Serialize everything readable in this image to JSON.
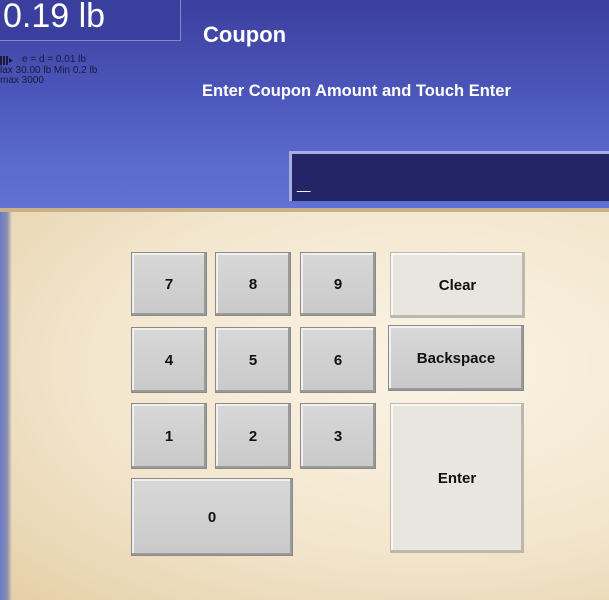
{
  "scale": {
    "weight": "0.19 lb",
    "lines": [
      "e = d = 0.01 lb",
      "lax 30.00 lb Min 0.2 lb",
      "max 3000"
    ],
    "icon": "scale-status-icon"
  },
  "header": {
    "title": "Coupon",
    "subtitle": "Enter Coupon Amount and Touch Enter"
  },
  "entry": {
    "value": "_"
  },
  "keypad": {
    "k7": "7",
    "k8": "8",
    "k9": "9",
    "k4": "4",
    "k5": "5",
    "k6": "6",
    "k1": "1",
    "k2": "2",
    "k3": "3",
    "k0": "0",
    "clear": "Clear",
    "backspace": "Backspace",
    "enter": "Enter"
  },
  "colors": {
    "header_blue": "#4a54b8",
    "entry_bg": "#242566",
    "panel_bg": "#f3e6ce",
    "key_bg": "#c9c9c9"
  }
}
